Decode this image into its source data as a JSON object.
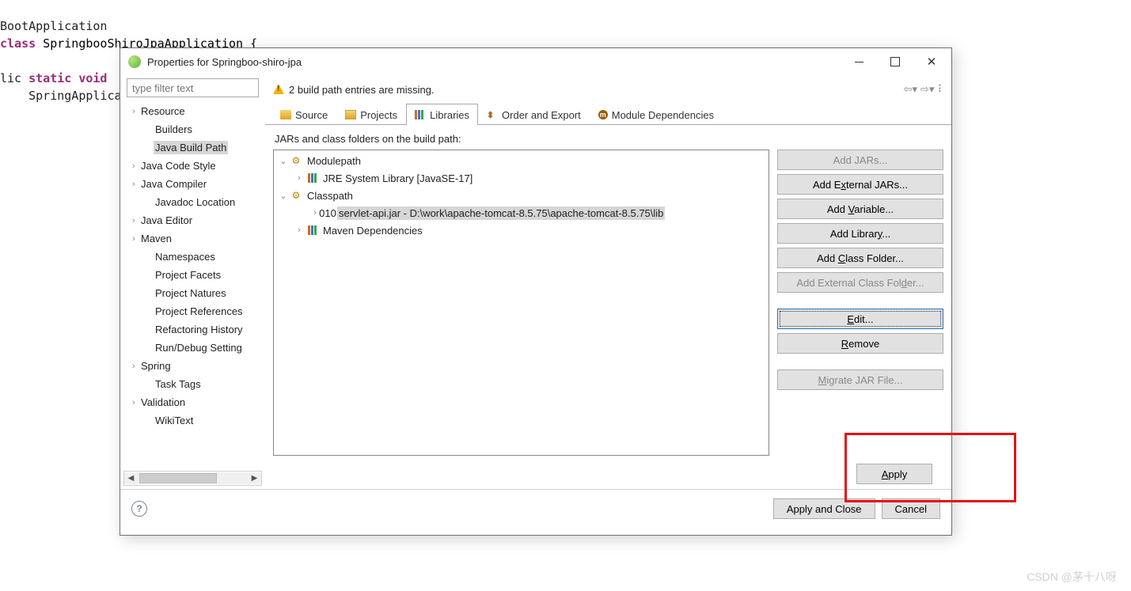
{
  "code": {
    "l1_pre": "BootApplication",
    "l2_kw": "class",
    "l2_rest": " SpringbooShiroJpaApplication {",
    "l4_pre": "lic ",
    "l4_kw": "static void",
    "l5_pre": "    SpringApplica"
  },
  "dialog": {
    "title": "Properties for Springboo-shiro-jpa",
    "filter_placeholder": "type filter text"
  },
  "sidebar": {
    "items": [
      {
        "label": "Resource",
        "expand": true,
        "lvl": 0
      },
      {
        "label": "Builders",
        "expand": false,
        "lvl": 1
      },
      {
        "label": "Java Build Path",
        "expand": false,
        "lvl": 1,
        "selected": true
      },
      {
        "label": "Java Code Style",
        "expand": true,
        "lvl": 0
      },
      {
        "label": "Java Compiler",
        "expand": true,
        "lvl": 0
      },
      {
        "label": "Javadoc Location",
        "expand": false,
        "lvl": 1
      },
      {
        "label": "Java Editor",
        "expand": true,
        "lvl": 0
      },
      {
        "label": "Maven",
        "expand": true,
        "lvl": 0
      },
      {
        "label": "Namespaces",
        "expand": false,
        "lvl": 1
      },
      {
        "label": "Project Facets",
        "expand": false,
        "lvl": 1
      },
      {
        "label": "Project Natures",
        "expand": false,
        "lvl": 1
      },
      {
        "label": "Project References",
        "expand": false,
        "lvl": 1
      },
      {
        "label": "Refactoring History",
        "expand": false,
        "lvl": 1
      },
      {
        "label": "Run/Debug Setting",
        "expand": false,
        "lvl": 1
      },
      {
        "label": "Spring",
        "expand": true,
        "lvl": 0
      },
      {
        "label": "Task Tags",
        "expand": false,
        "lvl": 1
      },
      {
        "label": "Validation",
        "expand": true,
        "lvl": 0
      },
      {
        "label": "WikiText",
        "expand": false,
        "lvl": 1
      }
    ]
  },
  "message": "2 build path entries are missing.",
  "tabs": {
    "t0": "Source",
    "t1": "Projects",
    "t2": "Libraries",
    "t3": "Order and Export",
    "t4": "Module Dependencies"
  },
  "list_label": "JARs and class folders on the build path:",
  "tree": {
    "n0": "Modulepath",
    "n1": "JRE System Library [JavaSE-17]",
    "n2": "Classpath",
    "n3": "servlet-api.jar - D:\\work\\apache-tomcat-8.5.75\\apache-tomcat-8.5.75\\lib",
    "n4": "Maven Dependencies"
  },
  "buttons": {
    "add_jars": "Add JARs...",
    "add_ext_jars_pre": "Add E",
    "add_ext_jars_u": "x",
    "add_ext_jars_post": "ternal JARs...",
    "add_var_pre": "Add ",
    "add_var_u": "V",
    "add_var_post": "ariable...",
    "add_lib_pre": "Add Librar",
    "add_lib_u": "y",
    "add_lib_post": "...",
    "add_cf_pre": "Add ",
    "add_cf_u": "C",
    "add_cf_post": "lass Folder...",
    "add_ecf_pre": "Add External Class Fol",
    "add_ecf_u": "d",
    "add_ecf_post": "er...",
    "edit_u": "E",
    "edit_post": "dit...",
    "remove_u": "R",
    "remove_post": "emove",
    "migrate_u": "M",
    "migrate_post": "igrate JAR File..."
  },
  "apply_u": "A",
  "apply_post": "pply",
  "footer": {
    "apply_close": "Apply and Close",
    "cancel": "Cancel"
  },
  "watermark": "CSDN @茅十八呀"
}
